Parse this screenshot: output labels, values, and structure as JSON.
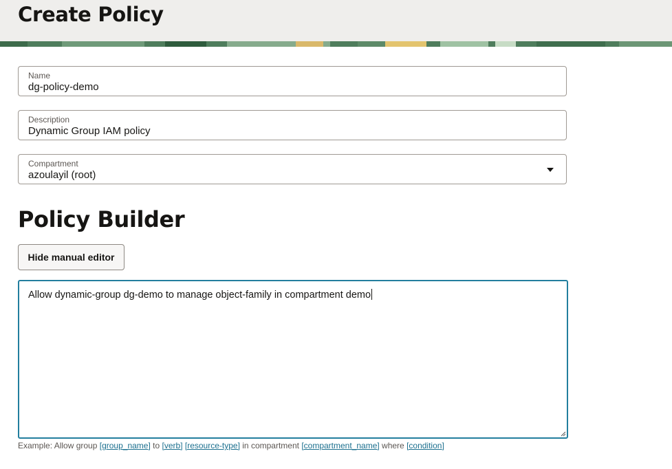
{
  "header": {
    "title": "Create Policy"
  },
  "form": {
    "name": {
      "label": "Name",
      "value": "dg-policy-demo"
    },
    "description": {
      "label": "Description",
      "value": "Dynamic Group IAM policy"
    },
    "compartment": {
      "label": "Compartment",
      "value": "azoulayil (root)"
    }
  },
  "policy_builder": {
    "title": "Policy Builder",
    "toggle_button_label": "Hide manual editor",
    "statement": "Allow dynamic-group dg-demo to manage object-family in compartment demo",
    "hint": {
      "prefix": "Example: Allow group",
      "group_link": "[group_name]",
      "to": "to",
      "verb_link": "[verb]",
      "resource_link": "[resource-type]",
      "in_compartment": "in compartment",
      "compartment_link": "[compartment_name]",
      "where": "where",
      "condition_link": "[condition]"
    }
  },
  "colors": {
    "header_bg": "#efeeec",
    "focus_border": "#227e9e",
    "link": "#1b6f8e",
    "banner_green": "#4f7d5c"
  }
}
